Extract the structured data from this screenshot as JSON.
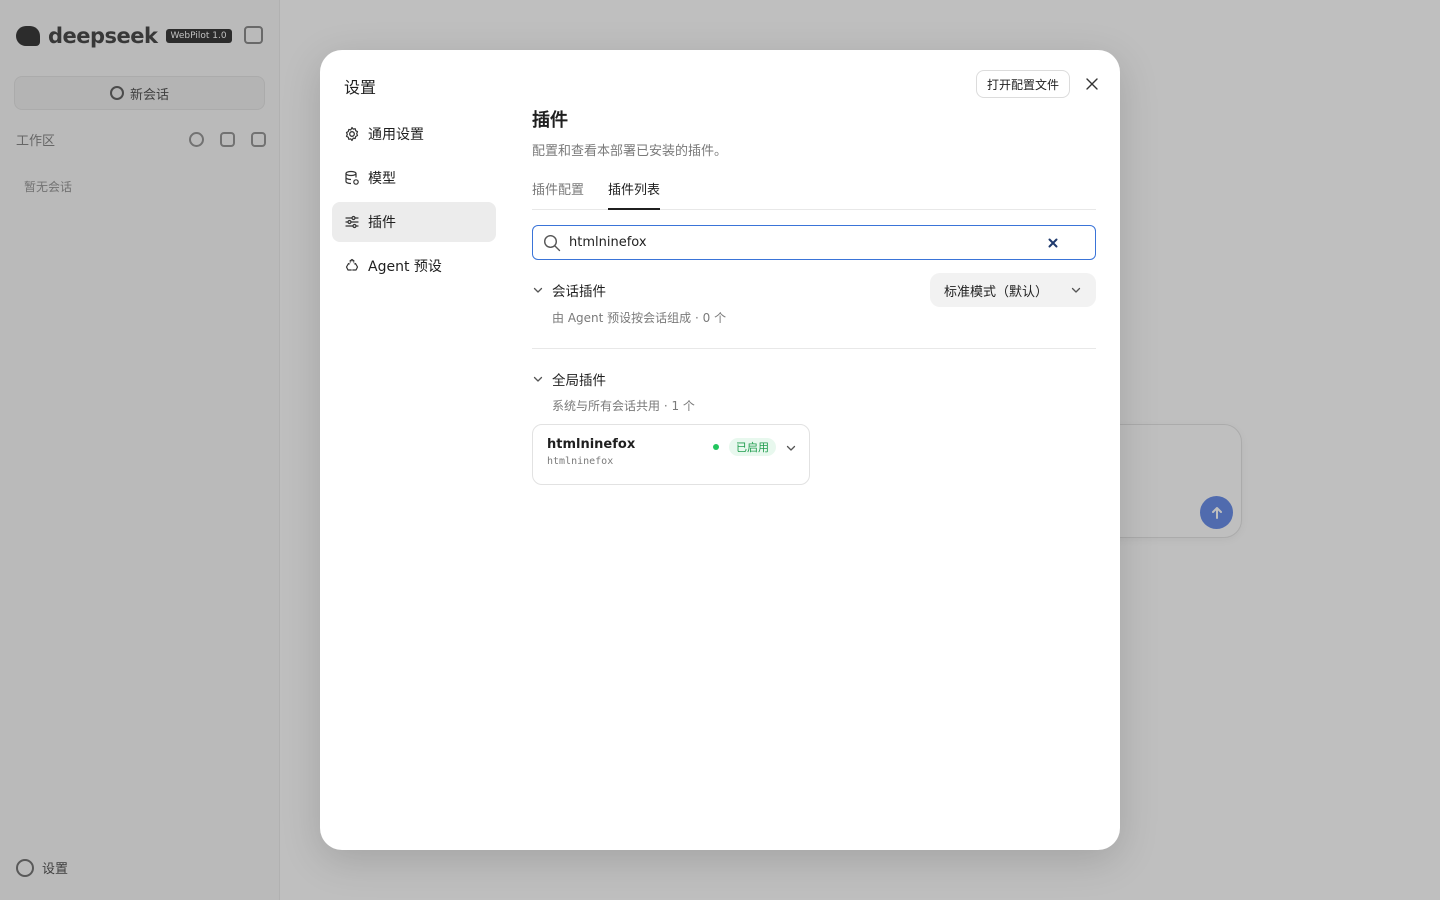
{
  "background": {
    "logo_text": "deepseek",
    "logo_badge": "WebPilot 1.0",
    "new_chat_label": "新会话",
    "workspace_label": "工作区",
    "empty_chats_label": "暂无会话",
    "settings_label": "设置",
    "send_icon": "arrow-up-icon"
  },
  "modal": {
    "title": "设置",
    "open_config_label": "打开配置文件",
    "nav": [
      {
        "label": "通用设置",
        "icon": "gear-icon"
      },
      {
        "label": "模型",
        "icon": "database-icon"
      },
      {
        "label": "插件",
        "icon": "sliders-icon"
      },
      {
        "label": "Agent 预设",
        "icon": "recycle-icon"
      }
    ],
    "active_nav": "插件",
    "section_title": "插件",
    "section_desc": "配置和查看本部署已安装的插件。",
    "tabs": [
      {
        "label": "插件配置",
        "active": false
      },
      {
        "label": "插件列表",
        "active": true
      }
    ],
    "search": {
      "value": "htmlninefox",
      "placeholder": ""
    },
    "session_group": {
      "name": "会话插件",
      "sub": "由 Agent 预设按会话组成",
      "count": "· 0 个",
      "mode_label": "标准模式（默认）"
    },
    "global_group": {
      "name": "全局插件",
      "sub": "系统与所有会话共用",
      "count": "· 1 个",
      "plugins": [
        {
          "name": "htmlninefox",
          "id": "htmlninefox",
          "status": "已启用",
          "status_color": "#22c55e"
        }
      ]
    }
  }
}
